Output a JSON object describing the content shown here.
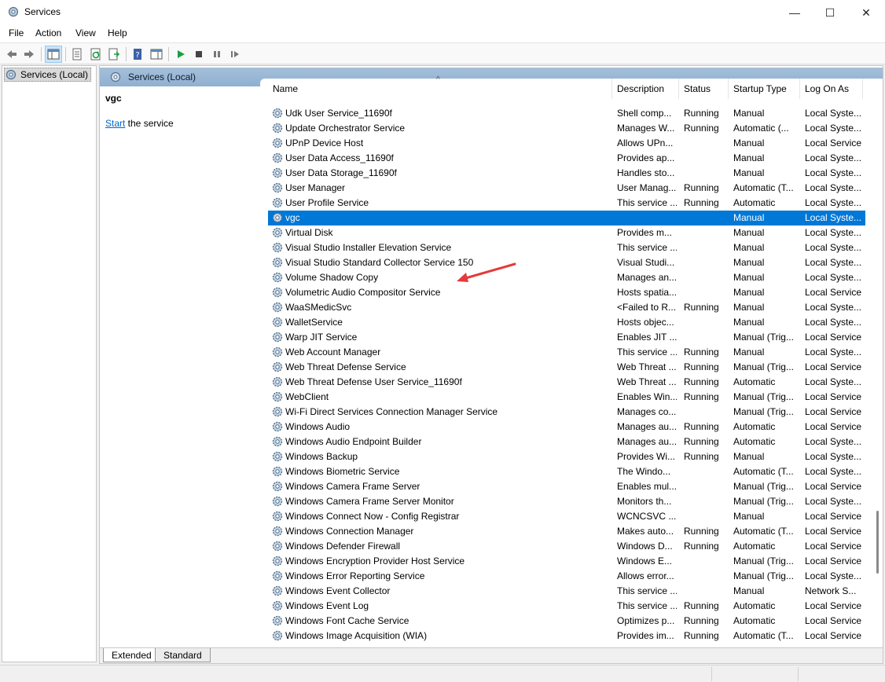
{
  "window": {
    "title": "Services",
    "minimize": "—",
    "maximize": "☐",
    "close": "✕"
  },
  "menu": {
    "file": "File",
    "action": "Action",
    "view": "View",
    "help": "Help"
  },
  "tree": {
    "root_label": "Services (Local)"
  },
  "main": {
    "header": "Services (Local)",
    "selected_name": "vgc",
    "start_link": "Start",
    "start_suffix": " the service"
  },
  "columns": {
    "name": "Name",
    "description": "Description",
    "status": "Status",
    "startup": "Startup Type",
    "logon": "Log On As",
    "sort_indicator": "^"
  },
  "tabs": {
    "extended": "Extended",
    "standard": "Standard"
  },
  "services": [
    {
      "name": "Udk User Service_11690f",
      "desc": "Shell comp...",
      "status": "Running",
      "startup": "Manual",
      "logon": "Local Syste..."
    },
    {
      "name": "Update Orchestrator Service",
      "desc": "Manages W...",
      "status": "Running",
      "startup": "Automatic (...",
      "logon": "Local Syste..."
    },
    {
      "name": "UPnP Device Host",
      "desc": "Allows UPn...",
      "status": "",
      "startup": "Manual",
      "logon": "Local Service"
    },
    {
      "name": "User Data Access_11690f",
      "desc": "Provides ap...",
      "status": "",
      "startup": "Manual",
      "logon": "Local Syste..."
    },
    {
      "name": "User Data Storage_11690f",
      "desc": "Handles sto...",
      "status": "",
      "startup": "Manual",
      "logon": "Local Syste..."
    },
    {
      "name": "User Manager",
      "desc": "User Manag...",
      "status": "Running",
      "startup": "Automatic (T...",
      "logon": "Local Syste..."
    },
    {
      "name": "User Profile Service",
      "desc": "This service ...",
      "status": "Running",
      "startup": "Automatic",
      "logon": "Local Syste..."
    },
    {
      "name": "vgc",
      "desc": "",
      "status": "",
      "startup": "Manual",
      "logon": "Local Syste...",
      "selected": true
    },
    {
      "name": "Virtual Disk",
      "desc": "Provides m...",
      "status": "",
      "startup": "Manual",
      "logon": "Local Syste..."
    },
    {
      "name": "Visual Studio Installer Elevation Service",
      "desc": "This service ...",
      "status": "",
      "startup": "Manual",
      "logon": "Local Syste..."
    },
    {
      "name": "Visual Studio Standard Collector Service 150",
      "desc": "Visual Studi...",
      "status": "",
      "startup": "Manual",
      "logon": "Local Syste..."
    },
    {
      "name": "Volume Shadow Copy",
      "desc": "Manages an...",
      "status": "",
      "startup": "Manual",
      "logon": "Local Syste..."
    },
    {
      "name": "Volumetric Audio Compositor Service",
      "desc": "Hosts spatia...",
      "status": "",
      "startup": "Manual",
      "logon": "Local Service"
    },
    {
      "name": "WaaSMedicSvc",
      "desc": "<Failed to R...",
      "status": "Running",
      "startup": "Manual",
      "logon": "Local Syste..."
    },
    {
      "name": "WalletService",
      "desc": "Hosts objec...",
      "status": "",
      "startup": "Manual",
      "logon": "Local Syste..."
    },
    {
      "name": "Warp JIT Service",
      "desc": "Enables JIT ...",
      "status": "",
      "startup": "Manual (Trig...",
      "logon": "Local Service"
    },
    {
      "name": "Web Account Manager",
      "desc": "This service ...",
      "status": "Running",
      "startup": "Manual",
      "logon": "Local Syste..."
    },
    {
      "name": "Web Threat Defense Service",
      "desc": "Web Threat ...",
      "status": "Running",
      "startup": "Manual (Trig...",
      "logon": "Local Service"
    },
    {
      "name": "Web Threat Defense User Service_11690f",
      "desc": "Web Threat ...",
      "status": "Running",
      "startup": "Automatic",
      "logon": "Local Syste..."
    },
    {
      "name": "WebClient",
      "desc": "Enables Win...",
      "status": "Running",
      "startup": "Manual (Trig...",
      "logon": "Local Service"
    },
    {
      "name": "Wi-Fi Direct Services Connection Manager Service",
      "desc": "Manages co...",
      "status": "",
      "startup": "Manual (Trig...",
      "logon": "Local Service"
    },
    {
      "name": "Windows Audio",
      "desc": "Manages au...",
      "status": "Running",
      "startup": "Automatic",
      "logon": "Local Service"
    },
    {
      "name": "Windows Audio Endpoint Builder",
      "desc": "Manages au...",
      "status": "Running",
      "startup": "Automatic",
      "logon": "Local Syste..."
    },
    {
      "name": "Windows Backup",
      "desc": "Provides Wi...",
      "status": "Running",
      "startup": "Manual",
      "logon": "Local Syste..."
    },
    {
      "name": "Windows Biometric Service",
      "desc": "The Windo...",
      "status": "",
      "startup": "Automatic (T...",
      "logon": "Local Syste..."
    },
    {
      "name": "Windows Camera Frame Server",
      "desc": "Enables mul...",
      "status": "",
      "startup": "Manual (Trig...",
      "logon": "Local Service"
    },
    {
      "name": "Windows Camera Frame Server Monitor",
      "desc": "Monitors th...",
      "status": "",
      "startup": "Manual (Trig...",
      "logon": "Local Syste..."
    },
    {
      "name": "Windows Connect Now - Config Registrar",
      "desc": "WCNCSVC ...",
      "status": "",
      "startup": "Manual",
      "logon": "Local Service"
    },
    {
      "name": "Windows Connection Manager",
      "desc": "Makes auto...",
      "status": "Running",
      "startup": "Automatic (T...",
      "logon": "Local Service"
    },
    {
      "name": "Windows Defender Firewall",
      "desc": "Windows D...",
      "status": "Running",
      "startup": "Automatic",
      "logon": "Local Service"
    },
    {
      "name": "Windows Encryption Provider Host Service",
      "desc": "Windows E...",
      "status": "",
      "startup": "Manual (Trig...",
      "logon": "Local Service"
    },
    {
      "name": "Windows Error Reporting Service",
      "desc": "Allows error...",
      "status": "",
      "startup": "Manual (Trig...",
      "logon": "Local Syste..."
    },
    {
      "name": "Windows Event Collector",
      "desc": "This service ...",
      "status": "",
      "startup": "Manual",
      "logon": "Network S..."
    },
    {
      "name": "Windows Event Log",
      "desc": "This service ...",
      "status": "Running",
      "startup": "Automatic",
      "logon": "Local Service"
    },
    {
      "name": "Windows Font Cache Service",
      "desc": "Optimizes p...",
      "status": "Running",
      "startup": "Automatic",
      "logon": "Local Service"
    },
    {
      "name": "Windows Image Acquisition (WIA)",
      "desc": "Provides im...",
      "status": "Running",
      "startup": "Automatic (T...",
      "logon": "Local Service"
    }
  ],
  "icons": {
    "app": "services-gear-icon",
    "back": "back-arrow-icon",
    "forward": "forward-arrow-icon",
    "row": "service-gear-icon"
  },
  "colors": {
    "selection": "#0078d7",
    "header_band": "#9bb8d6",
    "start_green": "#1b9e3e"
  }
}
